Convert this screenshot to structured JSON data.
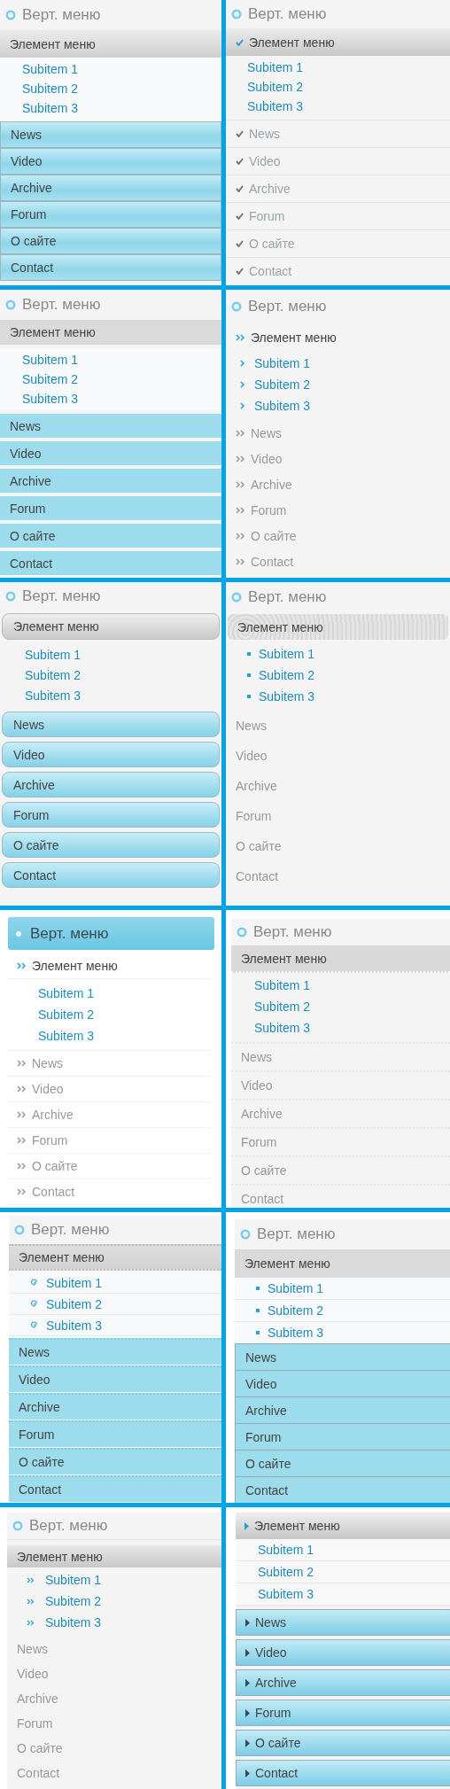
{
  "panels": [
    {
      "kind": "gloss",
      "title": "Верт. меню",
      "items": [
        {
          "label": "Элемент меню",
          "expanded": true,
          "children": [
            {
              "label": "Subitem 1"
            },
            {
              "label": "Subitem 2"
            },
            {
              "label": "Subitem 3"
            }
          ]
        },
        {
          "label": "News",
          "expanded": false
        },
        {
          "label": "Video",
          "expanded": false
        },
        {
          "label": "Archive",
          "expanded": false
        },
        {
          "label": "Forum",
          "expanded": false
        },
        {
          "label": "О сайте",
          "expanded": false
        },
        {
          "label": "Contact",
          "expanded": false
        }
      ]
    },
    {
      "kind": "check",
      "title": "Верт. меню",
      "items": [
        {
          "label": "Элемент меню",
          "expanded": true,
          "children": [
            {
              "label": "Subitem 1"
            },
            {
              "label": "Subitem 2"
            },
            {
              "label": "Subitem 3"
            }
          ]
        },
        {
          "label": "News",
          "expanded": false
        },
        {
          "label": "Video",
          "expanded": false
        },
        {
          "label": "Archive",
          "expanded": false
        },
        {
          "label": "Forum",
          "expanded": false
        },
        {
          "label": "О сайте",
          "expanded": false
        },
        {
          "label": "Contact",
          "expanded": false
        }
      ]
    },
    {
      "kind": "flat",
      "title": "Верт. меню",
      "items": [
        {
          "label": "Элемент меню",
          "expanded": true,
          "children": [
            {
              "label": "Subitem 1"
            },
            {
              "label": "Subitem 2"
            },
            {
              "label": "Subitem 3"
            }
          ]
        },
        {
          "label": "News",
          "expanded": false
        },
        {
          "label": "Video",
          "expanded": false
        },
        {
          "label": "Archive",
          "expanded": false
        },
        {
          "label": "Forum",
          "expanded": false
        },
        {
          "label": "О сайте",
          "expanded": false
        },
        {
          "label": "Contact",
          "expanded": false
        }
      ]
    },
    {
      "kind": "arrows",
      "title": "Верт. меню",
      "items": [
        {
          "label": "Элемент меню",
          "expanded": true,
          "children": [
            {
              "label": "Subitem 1"
            },
            {
              "label": "Subitem 2"
            },
            {
              "label": "Subitem 3"
            }
          ]
        },
        {
          "label": "News",
          "expanded": false
        },
        {
          "label": "Video",
          "expanded": false
        },
        {
          "label": "Archive",
          "expanded": false
        },
        {
          "label": "Forum",
          "expanded": false
        },
        {
          "label": "О сайте",
          "expanded": false
        },
        {
          "label": "Contact",
          "expanded": false
        }
      ]
    },
    {
      "kind": "pill",
      "title": "Верт. меню",
      "items": [
        {
          "label": "Элемент меню",
          "expanded": true,
          "children": [
            {
              "label": "Subitem 1"
            },
            {
              "label": "Subitem 2"
            },
            {
              "label": "Subitem 3"
            }
          ]
        },
        {
          "label": "News",
          "expanded": false
        },
        {
          "label": "Video",
          "expanded": false
        },
        {
          "label": "Archive",
          "expanded": false
        },
        {
          "label": "Forum",
          "expanded": false
        },
        {
          "label": "О сайте",
          "expanded": false
        },
        {
          "label": "Contact",
          "expanded": false
        }
      ]
    },
    {
      "kind": "pattern",
      "title": "Верт. меню",
      "items": [
        {
          "label": "Элемент меню",
          "expanded": true,
          "children": [
            {
              "label": "Subitem 1"
            },
            {
              "label": "Subitem 2"
            },
            {
              "label": "Subitem 3"
            }
          ]
        },
        {
          "label": "News",
          "expanded": false
        },
        {
          "label": "Video",
          "expanded": false
        },
        {
          "label": "Archive",
          "expanded": false
        },
        {
          "label": "Forum",
          "expanded": false
        },
        {
          "label": "О сайте",
          "expanded": false
        },
        {
          "label": "Contact",
          "expanded": false
        }
      ]
    },
    {
      "kind": "bar",
      "title": "Верт. меню",
      "items": [
        {
          "label": "Элемент меню",
          "expanded": true,
          "children": [
            {
              "label": "Subitem 1"
            },
            {
              "label": "Subitem 2"
            },
            {
              "label": "Subitem 3"
            }
          ]
        },
        {
          "label": "News",
          "expanded": false
        },
        {
          "label": "Video",
          "expanded": false
        },
        {
          "label": "Archive",
          "expanded": false
        },
        {
          "label": "Forum",
          "expanded": false
        },
        {
          "label": "О сайте",
          "expanded": false
        },
        {
          "label": "Contact",
          "expanded": false
        }
      ]
    },
    {
      "kind": "dotted",
      "title": "Верт. меню",
      "items": [
        {
          "label": "Элемент меню",
          "expanded": true,
          "children": [
            {
              "label": "Subitem 1"
            },
            {
              "label": "Subitem 2"
            },
            {
              "label": "Subitem 3"
            }
          ]
        },
        {
          "label": "News",
          "expanded": false
        },
        {
          "label": "Video",
          "expanded": false
        },
        {
          "label": "Archive",
          "expanded": false
        },
        {
          "label": "Forum",
          "expanded": false
        },
        {
          "label": "О сайте",
          "expanded": false
        },
        {
          "label": "Contact",
          "expanded": false
        }
      ]
    },
    {
      "kind": "split",
      "title": "Верт. меню",
      "items": [
        {
          "label": "Элемент меню",
          "expanded": true,
          "children": [
            {
              "label": "Subitem 1"
            },
            {
              "label": "Subitem 2"
            },
            {
              "label": "Subitem 3"
            }
          ]
        },
        {
          "label": "News",
          "expanded": false
        },
        {
          "label": "Video",
          "expanded": false
        },
        {
          "label": "Archive",
          "expanded": false
        },
        {
          "label": "Forum",
          "expanded": false
        },
        {
          "label": "О сайте",
          "expanded": false
        },
        {
          "label": "Contact",
          "expanded": false
        }
      ]
    },
    {
      "kind": "boxed",
      "title": "Верт. меню",
      "items": [
        {
          "label": "Элемент меню",
          "expanded": true,
          "children": [
            {
              "label": "Subitem 1"
            },
            {
              "label": "Subitem 2"
            },
            {
              "label": "Subitem 3"
            }
          ]
        },
        {
          "label": "News",
          "expanded": false
        },
        {
          "label": "Video",
          "expanded": false
        },
        {
          "label": "Archive",
          "expanded": false
        },
        {
          "label": "Forum",
          "expanded": false
        },
        {
          "label": "О сайте",
          "expanded": false
        },
        {
          "label": "Contact",
          "expanded": false
        }
      ]
    },
    {
      "kind": "soft",
      "title": "Верт. меню",
      "items": [
        {
          "label": "Элемент меню",
          "expanded": true,
          "children": [
            {
              "label": "Subitem 1"
            },
            {
              "label": "Subitem 2"
            },
            {
              "label": "Subitem 3"
            }
          ]
        },
        {
          "label": "News",
          "expanded": false
        },
        {
          "label": "Video",
          "expanded": false
        },
        {
          "label": "Archive",
          "expanded": false
        },
        {
          "label": "Forum",
          "expanded": false
        },
        {
          "label": "О сайте",
          "expanded": false
        },
        {
          "label": "Contact",
          "expanded": false
        }
      ]
    },
    {
      "kind": "tab",
      "items": [
        {
          "label": "Элемент меню",
          "expanded": true,
          "children": [
            {
              "label": "Subitem 1"
            },
            {
              "label": "Subitem 2"
            },
            {
              "label": "Subitem 3"
            }
          ]
        },
        {
          "label": "News",
          "expanded": false
        },
        {
          "label": "Video",
          "expanded": false
        },
        {
          "label": "Archive",
          "expanded": false
        },
        {
          "label": "Forum",
          "expanded": false
        },
        {
          "label": "О сайте",
          "expanded": false
        },
        {
          "label": "Contact",
          "expanded": false
        }
      ]
    }
  ]
}
